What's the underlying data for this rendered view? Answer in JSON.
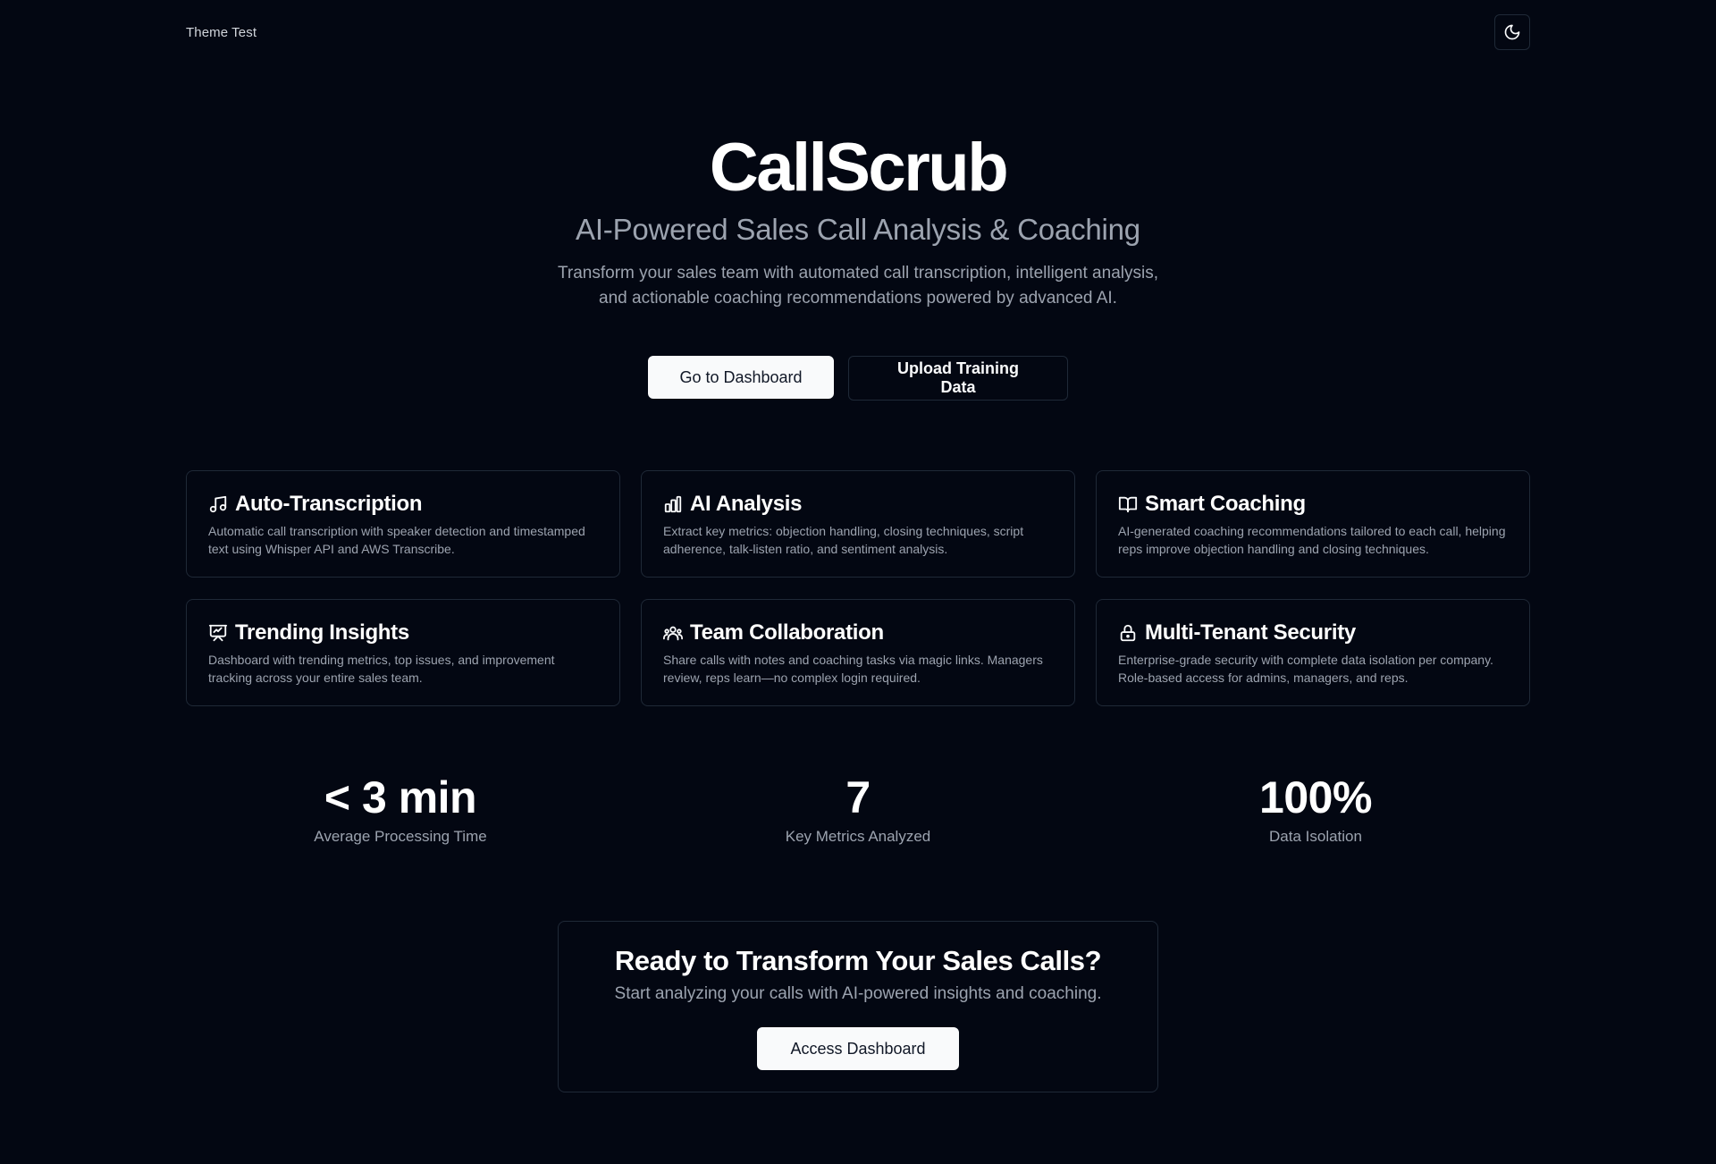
{
  "header": {
    "brand_label": "Theme Test",
    "theme_toggle_icon": "moon-icon"
  },
  "hero": {
    "title": "CallScrub",
    "subtitle": "AI-Powered Sales Call Analysis & Coaching",
    "description": "Transform your sales team with automated call transcription, intelligent analysis, and actionable coaching recommendations powered by advanced AI.",
    "primary_button": "Go to Dashboard",
    "secondary_button": "Upload Training Data"
  },
  "features": [
    {
      "icon": "music-note-icon",
      "title": "Auto-Transcription",
      "description": "Automatic call transcription with speaker detection and timestamped text using Whisper API and AWS Transcribe."
    },
    {
      "icon": "bar-chart-icon",
      "title": "AI Analysis",
      "description": "Extract key metrics: objection handling, closing techniques, script adherence, talk-listen ratio, and sentiment analysis."
    },
    {
      "icon": "book-open-icon",
      "title": "Smart Coaching",
      "description": "AI-generated coaching recommendations tailored to each call, helping reps improve objection handling and closing techniques."
    },
    {
      "icon": "presentation-chart-icon",
      "title": "Trending Insights",
      "description": "Dashboard with trending metrics, top issues, and improvement tracking across your entire sales team."
    },
    {
      "icon": "users-icon",
      "title": "Team Collaboration",
      "description": "Share calls with notes and coaching tasks via magic links. Managers review, reps learn—no complex login required."
    },
    {
      "icon": "lock-icon",
      "title": "Multi-Tenant Security",
      "description": "Enterprise-grade security with complete data isolation per company. Role-based access for admins, managers, and reps."
    }
  ],
  "stats": [
    {
      "value": "< 3 min",
      "label": "Average Processing Time"
    },
    {
      "value": "7",
      "label": "Key Metrics Analyzed"
    },
    {
      "value": "100%",
      "label": "Data Isolation"
    }
  ],
  "cta": {
    "title": "Ready to Transform Your Sales Calls?",
    "subtitle": "Start analyzing your calls with AI-powered insights and coaching.",
    "button": "Access Dashboard"
  },
  "colors": {
    "background": "#030712",
    "border": "#1f2937",
    "text_primary": "#ffffff",
    "text_muted": "#9ca3af",
    "button_light": "#f9fafb"
  }
}
